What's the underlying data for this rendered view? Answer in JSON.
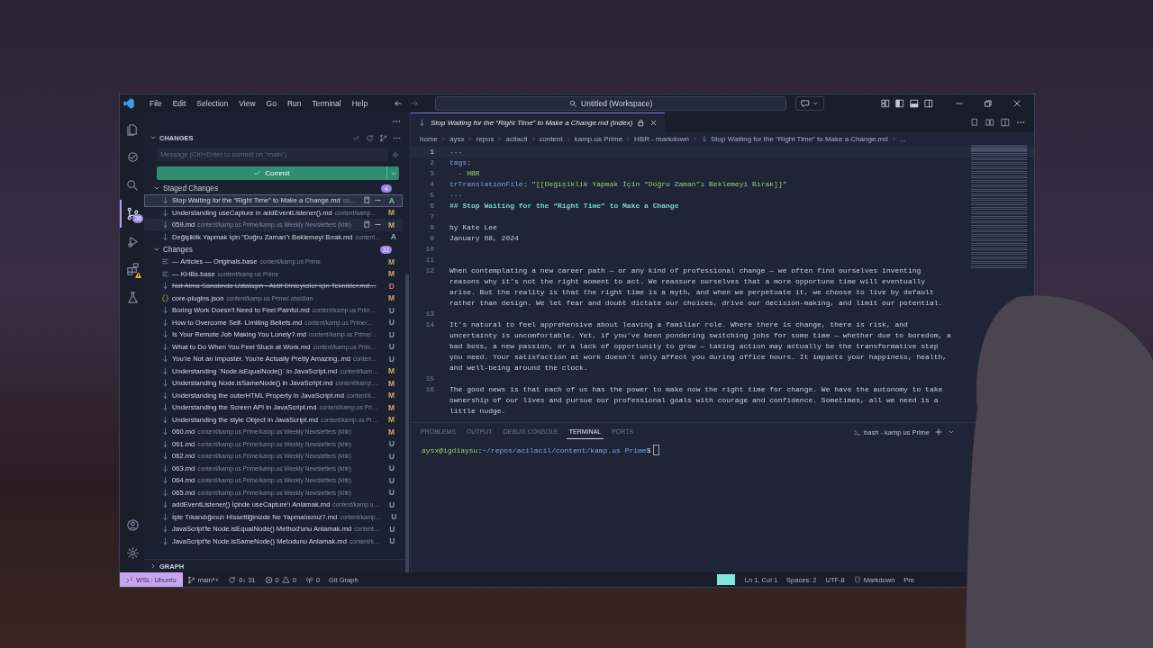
{
  "titlebar": {
    "menu": [
      "File",
      "Edit",
      "Selection",
      "View",
      "Go",
      "Run",
      "Terminal",
      "Help"
    ],
    "command_center": "Untitled (Workspace)"
  },
  "activity_bar": {
    "top": [
      {
        "kind": "files",
        "selected": false,
        "warning": false
      },
      {
        "kind": "remote",
        "selected": false,
        "warning": false
      },
      {
        "kind": "search",
        "selected": false,
        "warning": false
      },
      {
        "kind": "scm",
        "selected": true,
        "warning": false,
        "badge": "36"
      },
      {
        "kind": "run",
        "selected": false,
        "warning": false
      },
      {
        "kind": "extensions",
        "selected": false,
        "warning": true
      },
      {
        "kind": "testing",
        "selected": false,
        "warning": false
      }
    ],
    "bottom": [
      {
        "kind": "account",
        "selected": false,
        "warning": false
      },
      {
        "kind": "settings",
        "selected": false,
        "warning": false
      }
    ]
  },
  "scm": {
    "title": "CHANGES",
    "expanded": true,
    "message_placeholder": "Message (Ctrl+Enter to commit on \"main\")",
    "commit_button": "Commit",
    "staged": {
      "label": "Staged Changes",
      "count": "4",
      "expanded": true,
      "files": [
        {
          "kind": "markdown",
          "name": "Stop Waiting for the “Right Time” to Make a Change.md",
          "path": "co…",
          "status": "A",
          "color": "#8cc79f",
          "selected": true,
          "hovered": false,
          "deleted": false
        },
        {
          "kind": "markdown",
          "name": "Understanding useCapture in addEventListener().md",
          "path": "content/kamp…",
          "status": "M",
          "color": "#c9a66b",
          "selected": false,
          "hovered": false,
          "deleted": false
        },
        {
          "kind": "markdown",
          "name": "059.md",
          "path": "content/kamp.us Prime/kamp.us Weekly Newsletters (khb)",
          "status": "M",
          "color": "#c9a66b",
          "selected": false,
          "hovered": true,
          "deleted": false
        },
        {
          "kind": "markdown",
          "name": "Değişiklik Yapmak İçin “Doğru Zaman”ı Beklemeyi Bırak.md",
          "path": "content…",
          "status": "A",
          "color": "#8cc79f",
          "selected": false,
          "hovered": false,
          "deleted": false
        }
      ]
    },
    "changes": {
      "label": "Changes",
      "count": "32",
      "expanded": true,
      "files": [
        {
          "kind": "base",
          "name": "— Articles — Originals.base",
          "path": "content/kamp.us Prime",
          "status": "M",
          "color": "#c9a66b",
          "selected": false,
          "hovered": false,
          "deleted": false
        },
        {
          "kind": "base",
          "name": "— KHBs.base",
          "path": "content/kamp.us Prime",
          "status": "M",
          "color": "#c9a66b",
          "selected": false,
          "hovered": false,
          "deleted": false
        },
        {
          "kind": "markdown",
          "name": "Not Alma Sanatında Ustalaşın - Aktif Dinleyiciler için Teknikler.md…",
          "status": "D",
          "color": "#d9656b",
          "selected": false,
          "hovered": false,
          "deleted": true
        },
        {
          "kind": "json",
          "name": "core-plugins.json",
          "path": "content/kamp.us Prime/.obsidian",
          "status": "M",
          "color": "#c9a66b",
          "selected": false,
          "hovered": false,
          "deleted": false
        },
        {
          "kind": "markdown",
          "name": "Boring Work Doesn't Need to Feel Painful.md",
          "path": "content/kamp.us Prim…",
          "status": "U",
          "color": "#8a93b0",
          "selected": false,
          "hovered": false,
          "deleted": false
        },
        {
          "kind": "markdown",
          "name": "How to Overcome Self- Limiting Beliefs.md",
          "path": "content/kamp.us Prime/…",
          "status": "U",
          "color": "#8a93b0",
          "selected": false,
          "hovered": false,
          "deleted": false
        },
        {
          "kind": "markdown",
          "name": "Is Your Remote Job Making You Lonely?.md",
          "path": "content/kamp.us Prime/…",
          "status": "U",
          "color": "#8a93b0",
          "selected": false,
          "hovered": false,
          "deleted": false
        },
        {
          "kind": "markdown",
          "name": "What to Do When You Feel Stuck at Work.md",
          "path": "content/kamp.us Prim…",
          "status": "U",
          "color": "#8a93b0",
          "selected": false,
          "hovered": false,
          "deleted": false
        },
        {
          "kind": "markdown",
          "name": "You're Not an Imposter. You're Actually Pretty Amazing..md",
          "path": "conten…",
          "status": "U",
          "color": "#8a93b0",
          "selected": false,
          "hovered": false,
          "deleted": false
        },
        {
          "kind": "markdown",
          "name": "Understanding `Node.isEqualNode()` in JavaScript.md",
          "path": "content/kam…",
          "status": "M",
          "color": "#c9a66b",
          "selected": false,
          "hovered": false,
          "deleted": false
        },
        {
          "kind": "markdown",
          "name": "Understanding Node.isSameNode() in JavaScript.md",
          "path": "content/kamp.…",
          "status": "M",
          "color": "#c9a66b",
          "selected": false,
          "hovered": false,
          "deleted": false
        },
        {
          "kind": "markdown",
          "name": "Understanding the outerHTML Property in JavaScript.md",
          "path": "content/k…",
          "status": "M",
          "color": "#c9a66b",
          "selected": false,
          "hovered": false,
          "deleted": false
        },
        {
          "kind": "markdown",
          "name": "Understanding the Screen API in JavaScript.md",
          "path": "content/kamp.us Pri…",
          "status": "M",
          "color": "#c9a66b",
          "selected": false,
          "hovered": false,
          "deleted": false
        },
        {
          "kind": "markdown",
          "name": "Understanding the style Object in JavaScript.md",
          "path": "content/kamp.us Pr…",
          "status": "M",
          "color": "#c9a66b",
          "selected": false,
          "hovered": false,
          "deleted": false
        },
        {
          "kind": "markdown",
          "name": "060.md",
          "path": "content/kamp.us Prime/kamp.us Weekly Newsletters (khb)",
          "status": "M",
          "color": "#c9a66b",
          "selected": false,
          "hovered": false,
          "deleted": false
        },
        {
          "kind": "markdown",
          "name": "061.md",
          "path": "content/kamp.us Prime/kamp.us Weekly Newsletters (khb)",
          "status": "U",
          "color": "#8a93b0",
          "selected": false,
          "hovered": false,
          "deleted": false
        },
        {
          "kind": "markdown",
          "name": "062.md",
          "path": "content/kamp.us Prime/kamp.us Weekly Newsletters (khb)",
          "status": "U",
          "color": "#8a93b0",
          "selected": false,
          "hovered": false,
          "deleted": false
        },
        {
          "kind": "markdown",
          "name": "063.md",
          "path": "content/kamp.us Prime/kamp.us Weekly Newsletters (khb)",
          "status": "U",
          "color": "#8a93b0",
          "selected": false,
          "hovered": false,
          "deleted": false
        },
        {
          "kind": "markdown",
          "name": "064.md",
          "path": "content/kamp.us Prime/kamp.us Weekly Newsletters (khb)",
          "status": "U",
          "color": "#8a93b0",
          "selected": false,
          "hovered": false,
          "deleted": false
        },
        {
          "kind": "markdown",
          "name": "065.md",
          "path": "content/kamp.us Prime/kamp.us Weekly Newsletters (khb)",
          "status": "U",
          "color": "#8a93b0",
          "selected": false,
          "hovered": false,
          "deleted": false
        },
        {
          "kind": "markdown",
          "name": "addEventListener() İçinde useCapture'ı Anlamak.md",
          "path": "content/kamp.u…",
          "status": "U",
          "color": "#8a93b0",
          "selected": false,
          "hovered": false,
          "deleted": false
        },
        {
          "kind": "markdown",
          "name": "İşte Tıkandığınızı Hissettiğinizde Ne Yapmalısınız?.md",
          "path": "content/kamp…",
          "status": "U",
          "color": "#8a93b0",
          "selected": false,
          "hovered": false,
          "deleted": false
        },
        {
          "kind": "markdown",
          "name": "JavaScript'te Node.isEqualNode() Method'unu Anlamak.md",
          "path": "content…",
          "status": "U",
          "color": "#8a93b0",
          "selected": false,
          "hovered": false,
          "deleted": false
        },
        {
          "kind": "markdown",
          "name": "JavaScript'te Node.isSameNode() Metodunu Anlamak.md",
          "path": "content/k…",
          "status": "U",
          "color": "#8a93b0",
          "selected": false,
          "hovered": false,
          "deleted": false
        }
      ]
    },
    "graph": {
      "label": "GRAPH",
      "expanded": false
    }
  },
  "editor": {
    "tab": "Stop Waiting for the “Right Time” to Make a Change.md (Index)",
    "breadcrumbs": [
      "home",
      "aysx",
      "repos",
      "acilacil",
      "content",
      "kamp.us Prime",
      "HBR - markdown",
      "Stop Waiting for the “Right Time” to Make a Change.md",
      "..."
    ],
    "lines": [
      {
        "number": "1",
        "current": true,
        "segments": [
          {
            "kind": "punct",
            "text": "---"
          }
        ]
      },
      {
        "number": "2",
        "current": false,
        "segments": [
          {
            "kind": "key",
            "text": "tags"
          },
          {
            "kind": "text",
            "text": ":"
          }
        ]
      },
      {
        "number": "3",
        "current": false,
        "segments": [
          {
            "kind": "punct",
            "text": "  - "
          },
          {
            "kind": "value",
            "text": "HBR"
          }
        ]
      },
      {
        "number": "4",
        "current": false,
        "segments": [
          {
            "kind": "key",
            "text": "trTranslationFile"
          },
          {
            "kind": "text",
            "text": ": "
          },
          {
            "kind": "value",
            "text": "\"[[Değişiklik Yapmak İçin “Doğru Zaman”ı Beklemeyi Bırak]]\""
          }
        ]
      },
      {
        "number": "5",
        "current": false,
        "segments": [
          {
            "kind": "punct",
            "text": "---"
          }
        ]
      },
      {
        "number": "6",
        "current": false,
        "segments": [
          {
            "kind": "heading",
            "text": "## Stop Waiting for the “Right Time” to Make a Change"
          }
        ]
      },
      {
        "number": "7",
        "current": false
      },
      {
        "number": "8",
        "current": false,
        "segments": [
          {
            "kind": "text",
            "text": "by Kate Lee"
          }
        ]
      },
      {
        "number": "9",
        "current": false,
        "segments": [
          {
            "kind": "text",
            "text": "January 08, 2024"
          }
        ]
      },
      {
        "number": "10",
        "current": false
      },
      {
        "number": "11",
        "current": false
      },
      {
        "number": "12",
        "current": false,
        "segments": [
          {
            "kind": "text",
            "text": "When contemplating a new career path — or any kind of professional change — we often find ourselves inventing reasons why it’s not the right moment to act. We reassure ourselves that a more opportune time will eventually arise. But the reality is that the right time is a myth, and when we perpetuate it, we choose to live by default rather than design. We let fear and doubt dictate our choices, drive our decision-making, and limit our potential."
          }
        ]
      },
      {
        "number": "13",
        "current": false
      },
      {
        "number": "14",
        "current": false,
        "segments": [
          {
            "kind": "text",
            "text": "It’s natural to feel apprehensive about leaving a familiar role. Where there is change, there is risk, and uncertainty is uncomfortable. Yet, if you’ve been pondering switching jobs for some time — whether due to boredom, a bad boss, a new passion, or a lack of opportunity to grow — taking action may actually be the transformative step you need. Your satisfaction at work doesn’t only affect you during office hours. It impacts your happiness, health, and well-being around the clock."
          }
        ]
      },
      {
        "number": "15",
        "current": false
      },
      {
        "number": "16",
        "current": false,
        "segments": [
          {
            "kind": "text",
            "text": "The good news is that each of us has the power to make now the right time for change. We have the autonomy to take ownership of our lives and pursue our professional goals with courage and confidence. Sometimes, all we need is a little nudge."
          }
        ]
      }
    ]
  },
  "panel": {
    "tabs": [
      {
        "label": "PROBLEMS",
        "selected": false
      },
      {
        "label": "OUTPUT",
        "selected": false
      },
      {
        "label": "DEBUG CONSOLE",
        "selected": false
      },
      {
        "label": "TERMINAL",
        "selected": true
      },
      {
        "label": "PORTS",
        "selected": false
      }
    ],
    "terminal_name": "bash - kamp.us Prime",
    "prompt": [
      {
        "kind": "user",
        "text": "aysx@igdiaysu"
      },
      {
        "kind": "text",
        "text": ":"
      },
      {
        "kind": "path",
        "text": "~/repos/acilacil/content/kamp.us Prime"
      },
      {
        "kind": "text",
        "text": "$"
      }
    ]
  },
  "status_bar": {
    "remote": "WSL: Ubuntu",
    "branch": "main*+",
    "sync": "0↓ 31",
    "errors": "0",
    "warnings": "0",
    "ports": "0",
    "git_graph": "Git Graph",
    "right": [
      "Ln 1, Col 1",
      "Spaces: 2",
      "UTF-8",
      "Markdown",
      "Pre"
    ]
  }
}
